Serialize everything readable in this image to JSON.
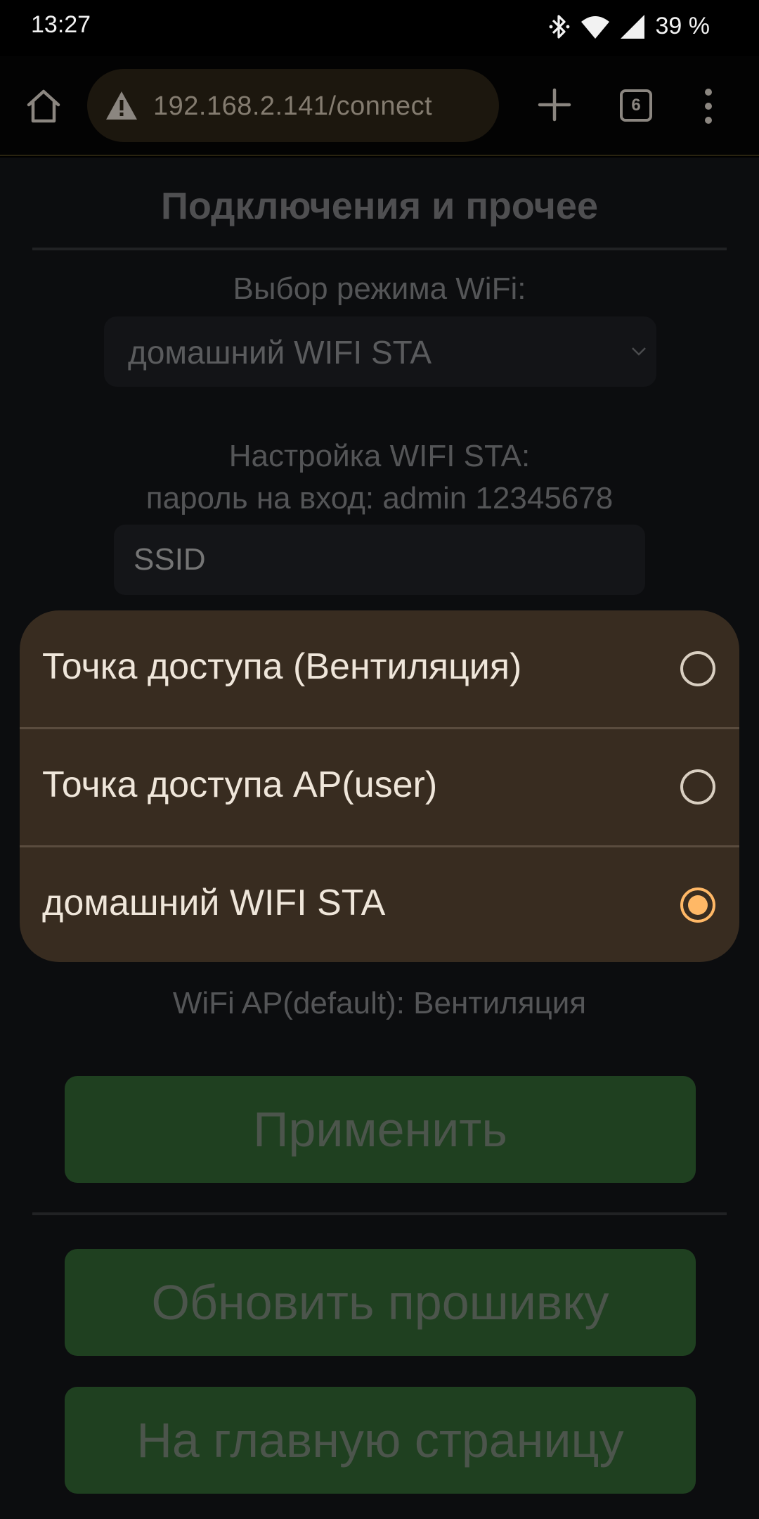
{
  "status_bar": {
    "time": "13:27",
    "battery": "39 %"
  },
  "browser": {
    "url": "192.168.2.141/connect",
    "tab_count": "6"
  },
  "page": {
    "title": "Подключения и прочее",
    "wifi_mode_label": "Выбор режима WiFi:",
    "wifi_mode_selected": "домашний WIFI STA",
    "sta_settings_label": "Настройка WIFI STA:",
    "login_info": "пароль на вход:   admin   12345678",
    "ssid_placeholder": "SSID",
    "ap_default_info": "WiFi AP(default):   Вентиляция",
    "apply_button": "Применить",
    "update_firmware_button": "Обновить прошивку",
    "home_button": "На главную страницу"
  },
  "popup": {
    "options": [
      {
        "label": "Точка доступа (Вентиляция)",
        "selected": false
      },
      {
        "label": "Точка доступа AP(user)",
        "selected": false
      },
      {
        "label": "домашний WIFI STA",
        "selected": true
      }
    ]
  },
  "colors": {
    "popup_bg": "#382c20",
    "radio_selected": "#ffb866",
    "button_green": "#1f4020"
  }
}
